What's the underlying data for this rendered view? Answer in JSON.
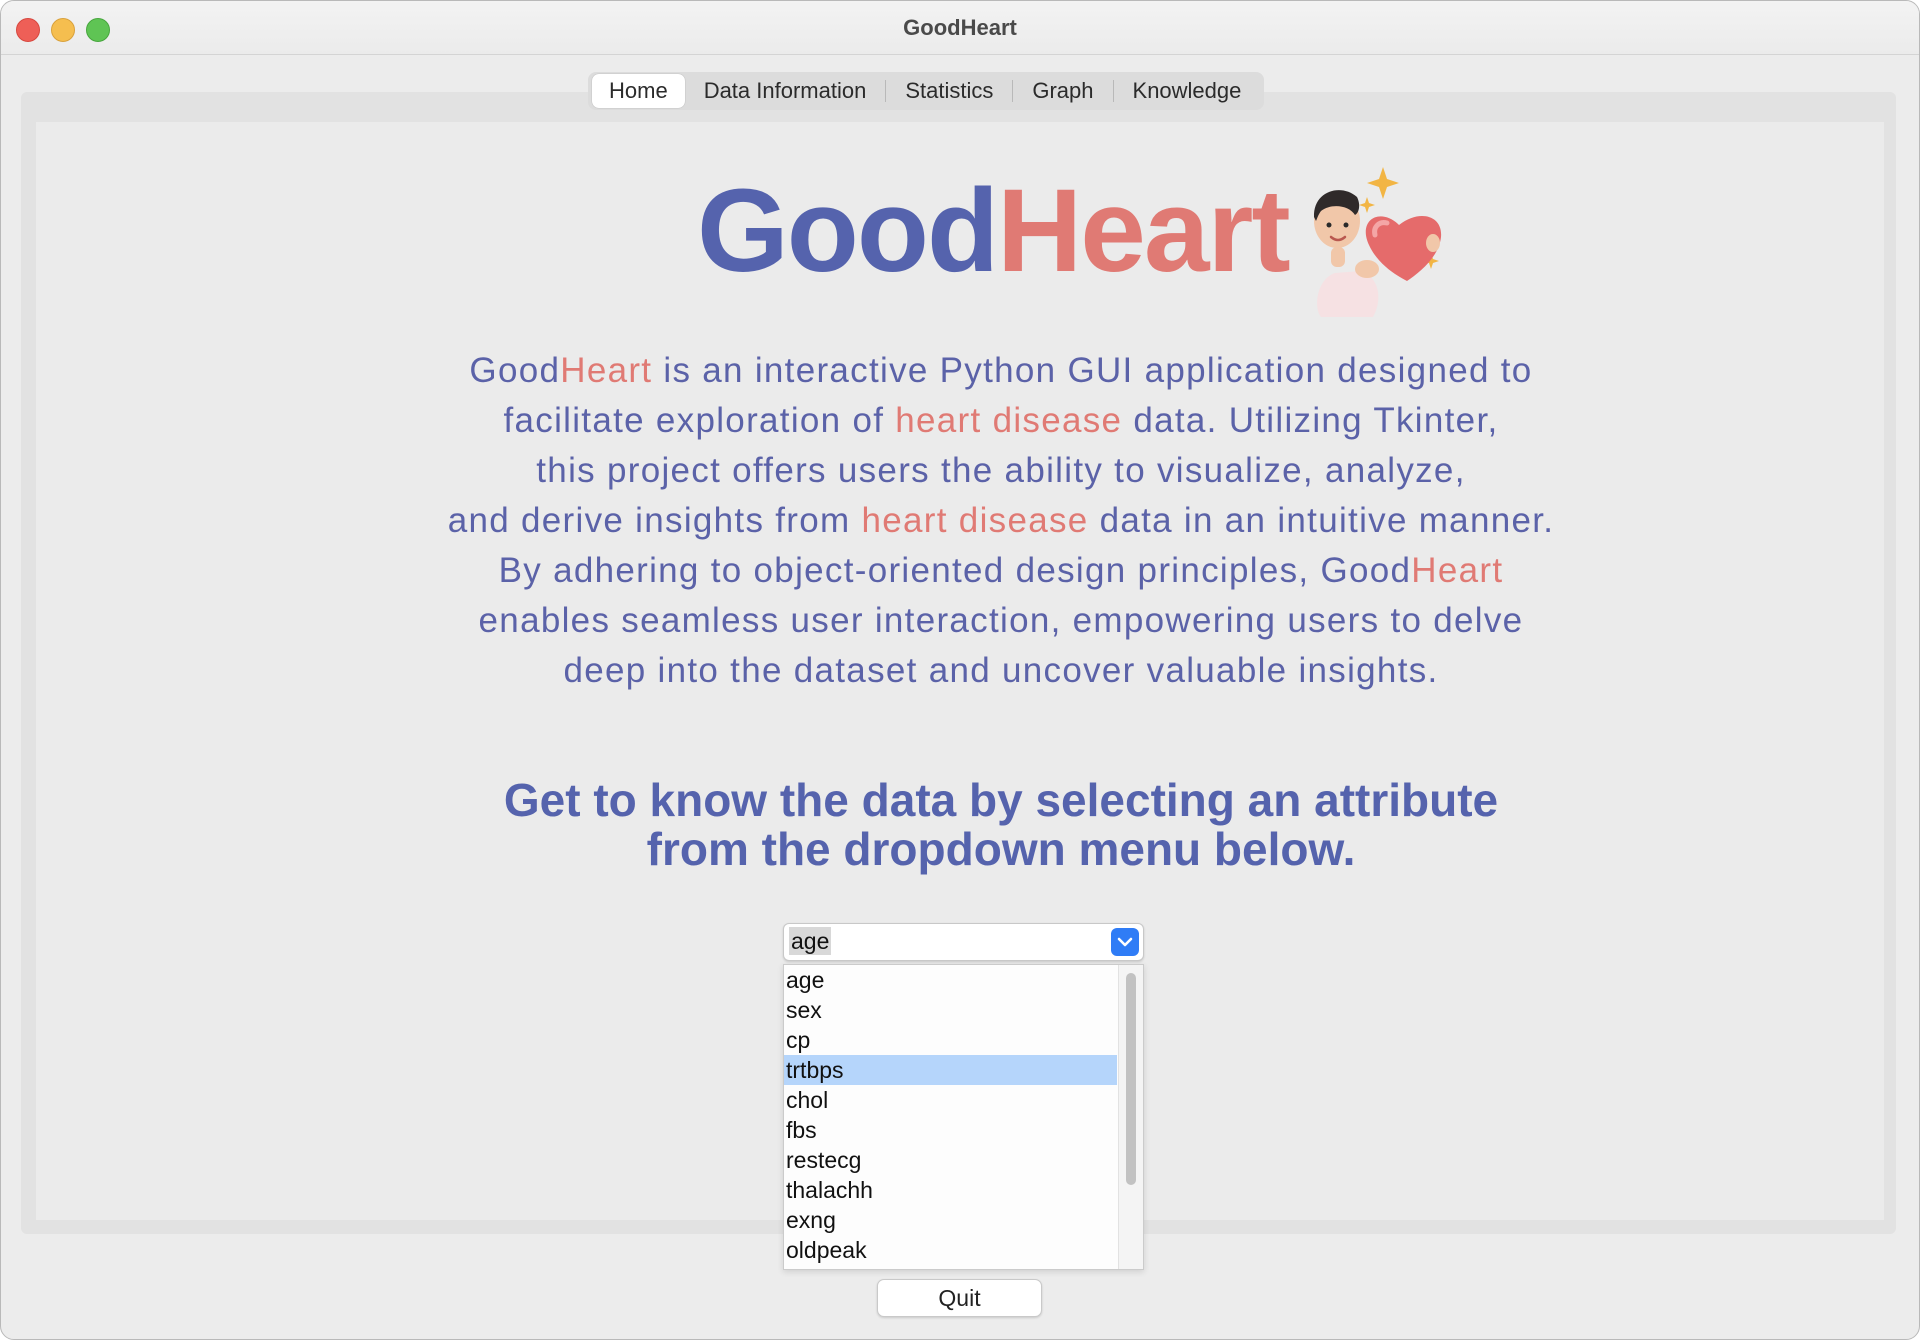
{
  "window": {
    "title": "GoodHeart"
  },
  "tabs": [
    {
      "label": "Home",
      "selected": true
    },
    {
      "label": "Data Information",
      "selected": false
    },
    {
      "label": "Statistics",
      "selected": false
    },
    {
      "label": "Graph",
      "selected": false
    },
    {
      "label": "Knowledge",
      "selected": false
    }
  ],
  "logo": {
    "part1": "Good",
    "part2": "Heart",
    "colors": {
      "part1": "#5563ad",
      "part2": "#e07a74"
    },
    "illustration": "heart-hugging-person-icon"
  },
  "description": {
    "lines": [
      [
        {
          "text": "Good",
          "accent": false
        },
        {
          "text": "Heart",
          "accent": true
        },
        {
          "text": " is an interactive Python GUI application designed to",
          "accent": false
        }
      ],
      [
        {
          "text": "facilitate exploration of ",
          "accent": false
        },
        {
          "text": "heart disease",
          "accent": true
        },
        {
          "text": " data. Utilizing Tkinter,",
          "accent": false
        }
      ],
      [
        {
          "text": "this project offers users the ability to visualize, analyze,",
          "accent": false
        }
      ],
      [
        {
          "text": "and derive insights from ",
          "accent": false
        },
        {
          "text": "heart disease",
          "accent": true
        },
        {
          "text": " data in an intuitive manner.",
          "accent": false
        }
      ],
      [
        {
          "text": "By adhering to object-oriented design principles, Good",
          "accent": false
        },
        {
          "text": "Heart",
          "accent": true
        }
      ],
      [
        {
          "text": "enables seamless user interaction, empowering users to delve",
          "accent": false
        }
      ],
      [
        {
          "text": "deep into the dataset and uncover valuable insights.",
          "accent": false
        }
      ]
    ],
    "colors": {
      "base": "#5b62a8",
      "accent": "#e07a74"
    }
  },
  "prompt": {
    "line1": "Get to know the data by selecting an attribute",
    "line2": "from the dropdown menu below."
  },
  "attribute_select": {
    "value": "age",
    "options": [
      "age",
      "sex",
      "cp",
      "trtbps",
      "chol",
      "fbs",
      "restecg",
      "thalachh",
      "exng",
      "oldpeak"
    ],
    "highlighted": "trtbps",
    "accent": "#2f7cf6",
    "highlight_color": "#b5d5fb"
  },
  "quit_button": {
    "label": "Quit"
  }
}
